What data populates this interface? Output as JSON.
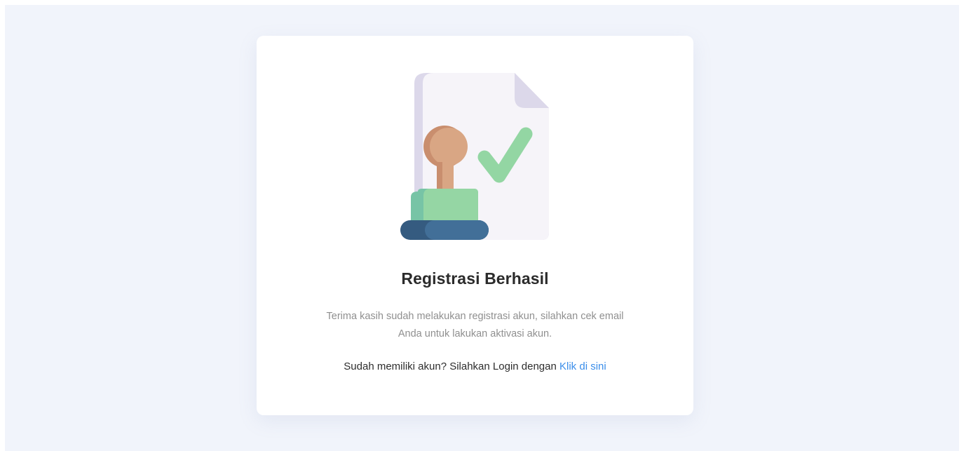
{
  "card": {
    "title": "Registrasi Berhasil",
    "description_line1": "Terima kasih sudah melakukan registrasi akun, silahkan cek email",
    "description_line2": "Anda untuk lakukan aktivasi akun.",
    "login_prompt": "Sudah memiliki akun? Silahkan Login dengan",
    "login_link": "Klik di sini"
  },
  "illustration": {
    "icon": "approval-stamp-document-icon"
  },
  "colors": {
    "page_background": "#f1f4fb",
    "card_background": "#ffffff",
    "title": "#2b2b2b",
    "description": "#8f8f8f",
    "link": "#3b8eea",
    "check": "#93d6a3",
    "stamp_handle": "#d9a684",
    "stamp_body": "#95d6a4",
    "stamp_base": "#3f6f97",
    "document": "#f6f4f9",
    "document_fold": "#dcd8ea"
  }
}
